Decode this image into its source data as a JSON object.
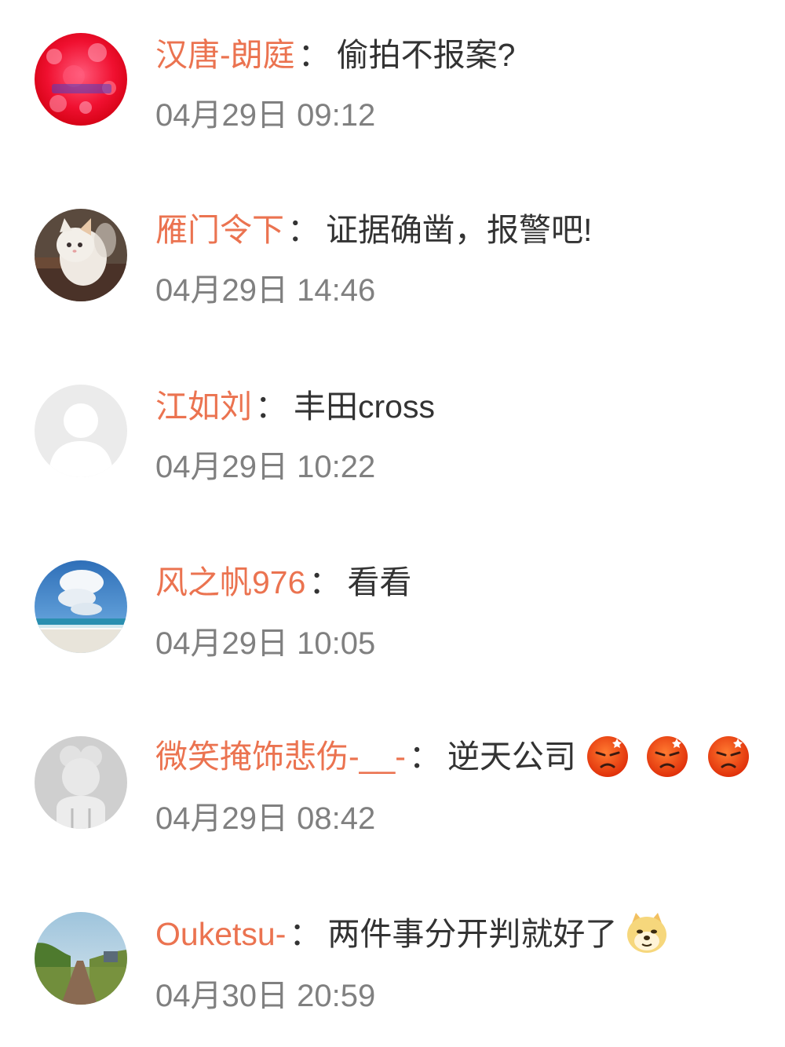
{
  "colors": {
    "username": "#eb7350",
    "text": "#333333",
    "time": "#808080"
  },
  "comments": [
    {
      "avatar": "red-bokeh-avatar",
      "username": "汉唐-朗庭",
      "colon": "：",
      "text": "偷拍不报案?",
      "time": "04月29日 09:12"
    },
    {
      "avatar": "kitten-photo-avatar",
      "username": "雁门令下",
      "colon": "：",
      "text": "证据确凿，报警吧!",
      "time": "04月29日 14:46"
    },
    {
      "avatar": "default-user-avatar",
      "username": "江如刘",
      "colon": "：",
      "text": "丰田cross",
      "time": "04月29日 10:22"
    },
    {
      "avatar": "sky-beach-avatar",
      "username": "风之帆976",
      "colon": "：",
      "text": "看看",
      "time": "04月29日 10:05"
    },
    {
      "avatar": "grey-illustration-avatar",
      "username": "微笑掩饰悲伤-__-",
      "colon": "：",
      "text": "逆天公司",
      "emojis": [
        "angry-face-emoji",
        "angry-face-emoji",
        "angry-face-emoji"
      ],
      "time": "04月29日 08:42"
    },
    {
      "avatar": "landscape-path-avatar",
      "username": "Ouketsu-",
      "colon": "：",
      "text": "两件事分开判就好了",
      "emojis": [
        "doge-emoji"
      ],
      "time": "04月30日 20:59"
    }
  ]
}
